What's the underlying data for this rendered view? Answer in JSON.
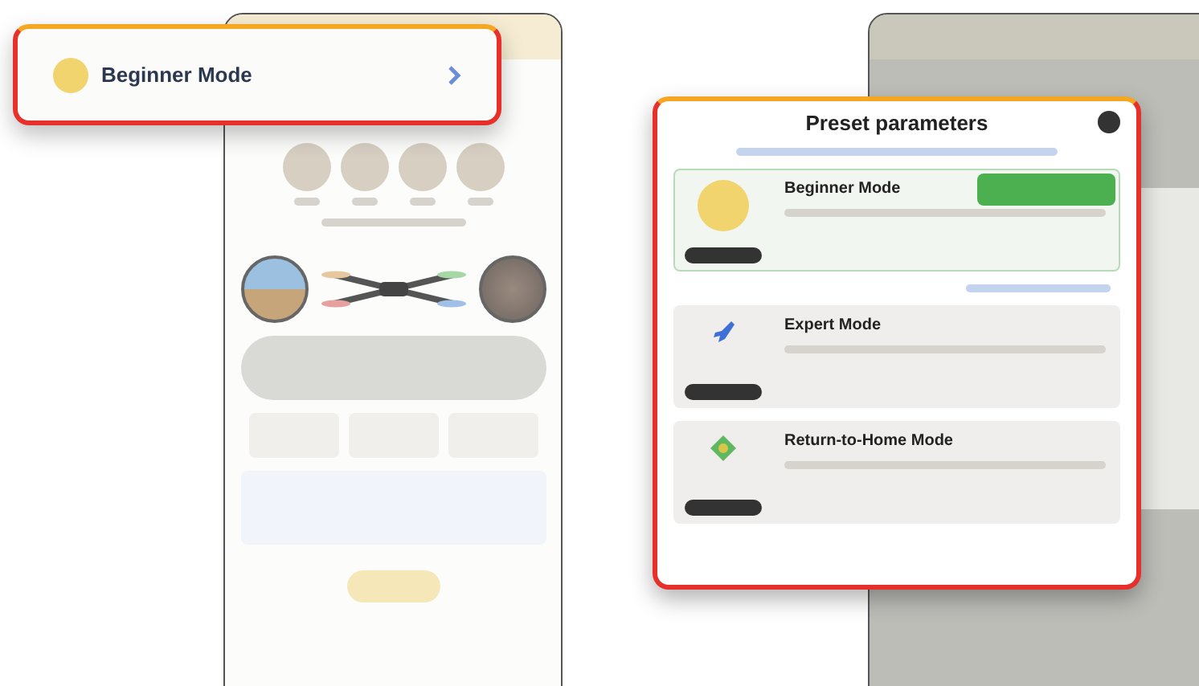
{
  "callout": {
    "title": "Beginner Mode"
  },
  "modal": {
    "title": "Preset parameters",
    "presets": [
      {
        "name": "Beginner Mode",
        "kind": "sun",
        "selected": true
      },
      {
        "name": "Expert Mode",
        "kind": "rocket",
        "selected": false
      },
      {
        "name": "Return-to-Home Mode",
        "kind": "home",
        "selected": false
      }
    ]
  }
}
